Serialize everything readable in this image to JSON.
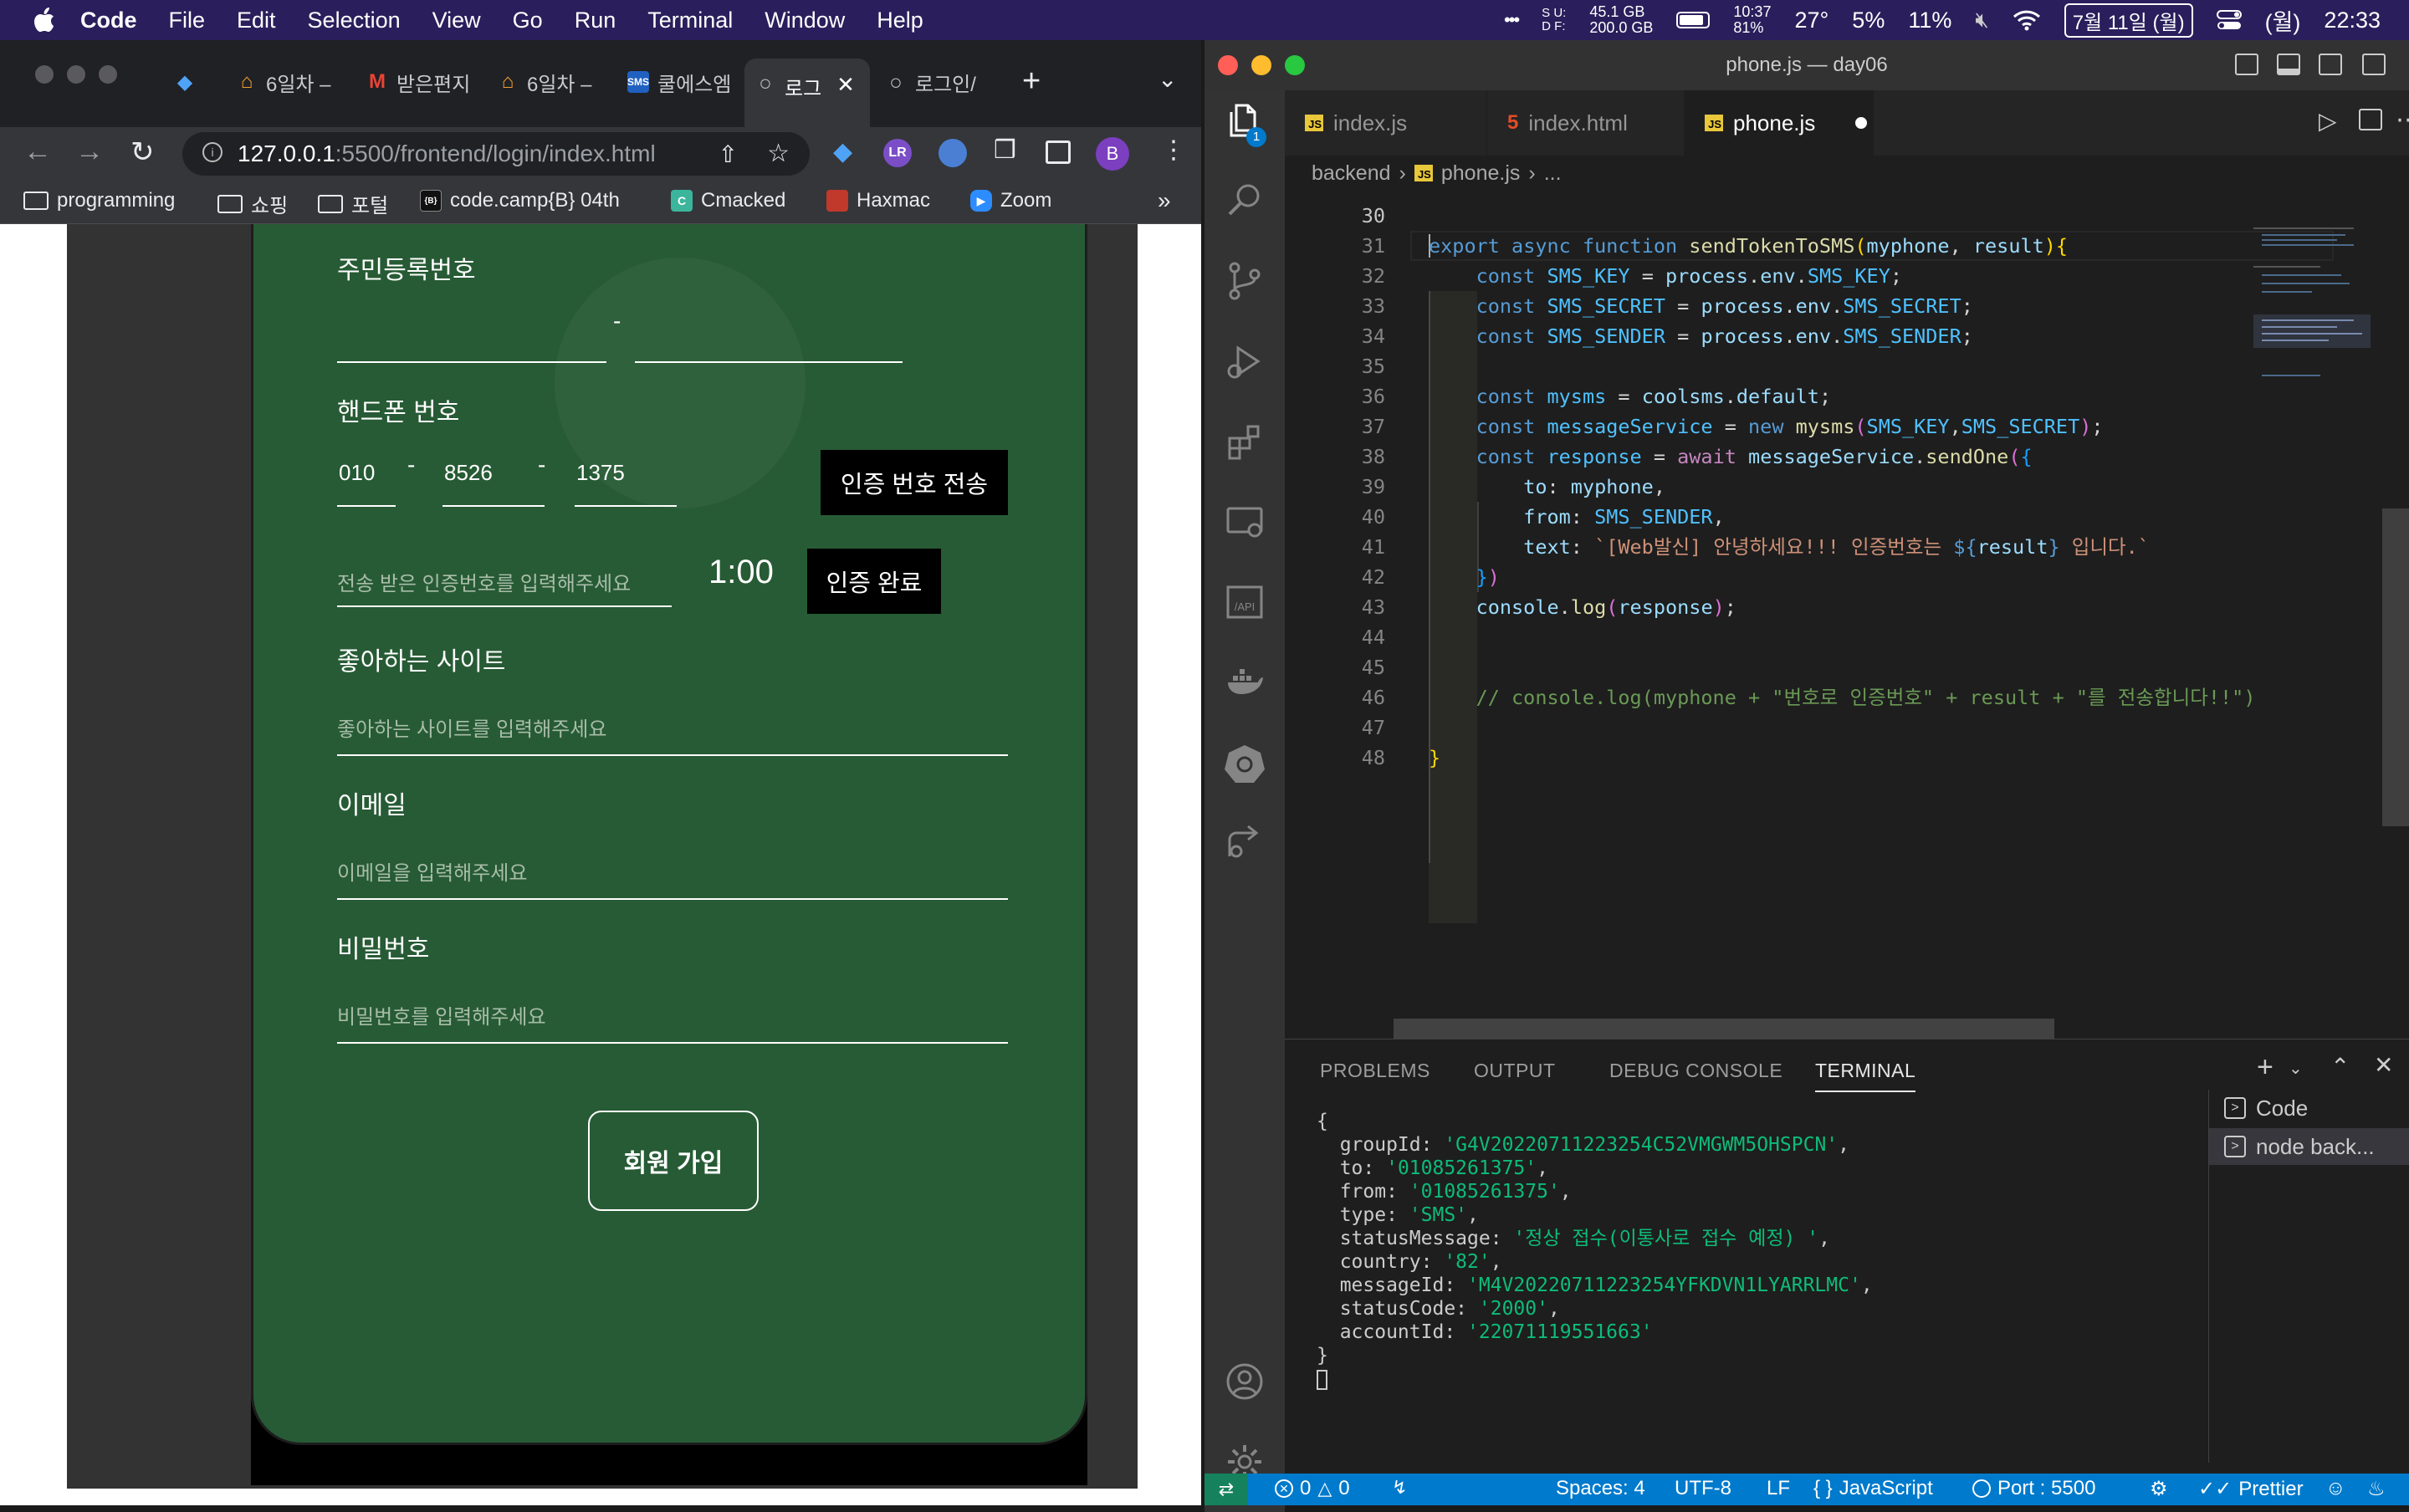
{
  "menubar": {
    "app": "Code",
    "items": [
      "File",
      "Edit",
      "Selection",
      "View",
      "Go",
      "Run",
      "Terminal",
      "Window",
      "Help"
    ],
    "dots": "•••",
    "disk_label": "S U:\nD F:",
    "disk_values": [
      "45.1 GB",
      "200.0 GB"
    ],
    "battery_time": "10:37",
    "battery_pct": "81%",
    "temp": "27°",
    "cpu": "5%",
    "mem": "11%",
    "date": "7월 11일 (월)",
    "day": "(월)",
    "clock": "22:33"
  },
  "chrome": {
    "tabs": [
      {
        "label": "",
        "icon": "diamond-icon"
      },
      {
        "label": "6일차 –",
        "icon": "home-icon"
      },
      {
        "label": "받은편지",
        "icon": "gmail-icon"
      },
      {
        "label": "6일차 –",
        "icon": "home-icon"
      },
      {
        "label": "쿨에스엠",
        "icon": "sms-icon"
      },
      {
        "label": "로그",
        "icon": "globe-icon",
        "active": true
      },
      {
        "label": "로그인/",
        "icon": "globe-icon"
      }
    ],
    "url_host": "127.0.0.1",
    "url_rest": ":5500/frontend/login/index.html",
    "profile_initial": "B",
    "bookmarks": [
      "programming",
      "쇼핑",
      "포털",
      "code.camp{B} 04th",
      "Cmacked",
      "Haxmac",
      "Zoom"
    ],
    "bookmarks_more": "»"
  },
  "form": {
    "ssn_label": "주민등록번호",
    "ssn_dash": "-",
    "phone_label": "핸드폰 번호",
    "phone1": "010",
    "phone2": "8526",
    "phone3": "1375",
    "phone_dash": "-",
    "send_button": "인증 번호 전송",
    "token_placeholder": "전송 받은 인증번호를 입력해주세요",
    "timer": "1:00",
    "verify_button": "인증 완료",
    "site_label": "좋아하는 사이트",
    "site_placeholder": "좋아하는 사이트를 입력해주세요",
    "email_label": "이메일",
    "email_placeholder": "이메일을 입력해주세요",
    "pw_label": "비밀번호",
    "pw_placeholder": "비밀번호를 입력해주세요",
    "join_button": "회원 가입"
  },
  "vscode": {
    "title": "phone.js — day06",
    "tabs": [
      {
        "label": "index.js",
        "type": "js"
      },
      {
        "label": "index.html",
        "type": "html"
      },
      {
        "label": "phone.js",
        "type": "js",
        "active": true,
        "dirty": true
      }
    ],
    "breadcrumb": [
      "backend",
      "phone.js",
      "..."
    ],
    "explorer_badge": "1",
    "code_lines": [
      30,
      31,
      32,
      33,
      34,
      35,
      36,
      37,
      38,
      39,
      40,
      41,
      42,
      43,
      44,
      45,
      46,
      47,
      48
    ],
    "panel_tabs": [
      "PROBLEMS",
      "OUTPUT",
      "DEBUG CONSOLE",
      "TERMINAL"
    ],
    "terminal": {
      "open": "{",
      "fields": [
        {
          "key": "groupId",
          "value": "'G4V20220711223254C52VMGWM5OHSPCN'"
        },
        {
          "key": "to",
          "value": "'01085261375'"
        },
        {
          "key": "from",
          "value": "'01085261375'"
        },
        {
          "key": "type",
          "value": "'SMS'"
        },
        {
          "key": "statusMessage",
          "value": "'정상 접수(이통사로 접수 예정) '"
        },
        {
          "key": "country",
          "value": "'82'"
        },
        {
          "key": "messageId",
          "value": "'M4V20220711223254YFKDVN1LYARRLMC'"
        },
        {
          "key": "statusCode",
          "value": "'2000'"
        },
        {
          "key": "accountId",
          "value": "'22071119551663'"
        }
      ],
      "close": "}"
    },
    "terminals": [
      "Code",
      "node back..."
    ],
    "status": {
      "errors": "0",
      "warnings": "0",
      "spaces": "Spaces: 4",
      "encoding": "UTF-8",
      "eol": "LF",
      "braces": "{ }",
      "language": "JavaScript",
      "port": "Port : 5500",
      "prettier": "Prettier"
    }
  },
  "colors": {
    "menubar": "#2a1f5c",
    "green_card": "#275b35",
    "statusbar": "#007acc"
  }
}
